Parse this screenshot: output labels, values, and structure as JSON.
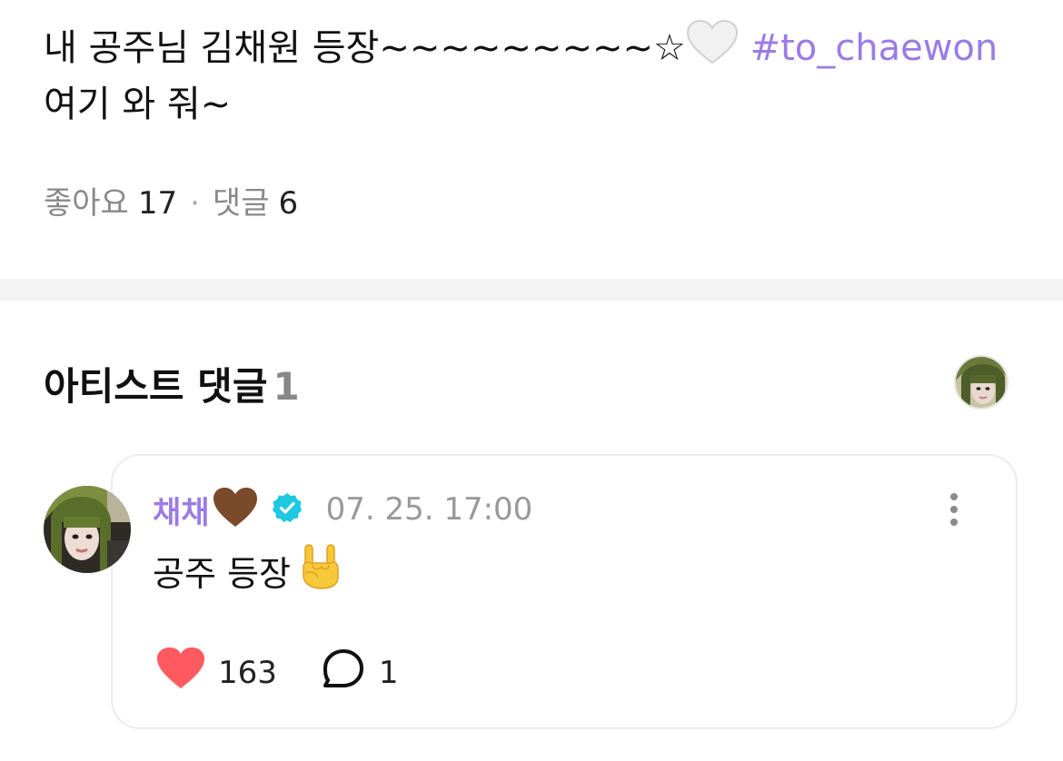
{
  "post": {
    "text_line1": "내 공주님 김채원 등장~~~~~~~~~☆",
    "hashtag": "#to_chaewon",
    "text_line2": "여기 와 줘~"
  },
  "stats": {
    "likes_label": "좋아요",
    "likes_count": "17",
    "separator": "·",
    "comments_label": "댓글",
    "comments_count": "6"
  },
  "artist_comments": {
    "title": "아티스트 댓글",
    "count": "1"
  },
  "comment": {
    "author": "채채",
    "timestamp": "07. 25. 17:00",
    "body": "공주 등장",
    "like_count": "163",
    "reply_count": "1"
  },
  "colors": {
    "accent": "#9b7be6",
    "verified": "#1ec8e0",
    "like_heart": "#ff5a5f",
    "divider": "#f3f3f3"
  },
  "icons": [
    "white-heart-icon",
    "brown-heart-icon",
    "verified-badge-icon",
    "more-options-icon",
    "heart-icon",
    "reply-bubble-icon",
    "rock-hand-emoji-icon"
  ]
}
